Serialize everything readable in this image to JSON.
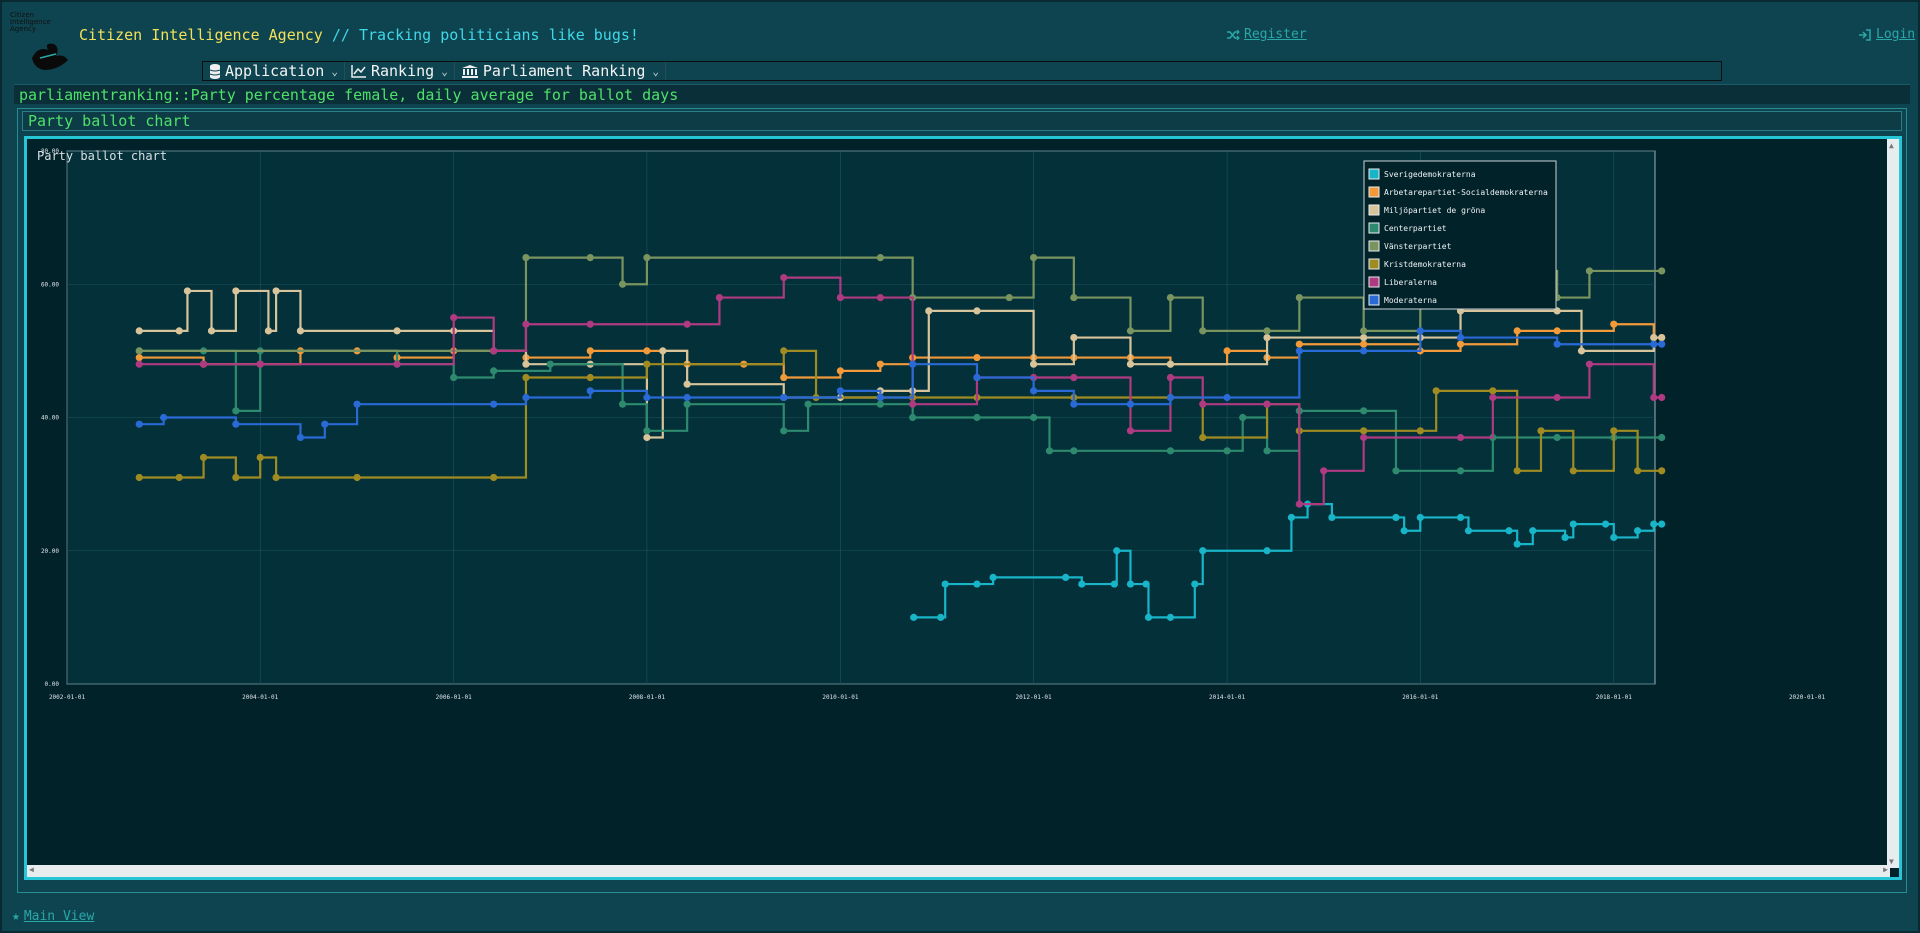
{
  "header": {
    "logo_text": "Citizen Intelligence Agency",
    "title": "Citizen Intelligence Agency",
    "separator": "//",
    "tagline": "Tracking politicians like bugs!",
    "register_label": "Register",
    "login_label": "Login"
  },
  "menubar": {
    "items": [
      {
        "label": "Application",
        "icon": "database-icon"
      },
      {
        "label": "Ranking",
        "icon": "line-chart-icon"
      },
      {
        "label": "Parliament Ranking",
        "icon": "institution-icon"
      }
    ]
  },
  "page": {
    "title": "parliamentranking::Party percentage female, daily average for ballot days",
    "panel_caption": "Party ballot chart",
    "chart_caption": "Party ballot chart"
  },
  "footer": {
    "main_view_label": "Main View"
  },
  "chart_data": {
    "type": "line",
    "title": "Party ballot chart",
    "xlabel": "",
    "ylabel": "",
    "xlim": [
      "2002-01-01",
      "2020-01-01"
    ],
    "ylim": [
      0,
      80
    ],
    "x_ticks": [
      "2002-01-01",
      "2004-01-01",
      "2006-01-01",
      "2008-01-01",
      "2010-01-01",
      "2012-01-01",
      "2014-01-01",
      "2016-01-01",
      "2018-01-01",
      "2020-01-01"
    ],
    "y_ticks": [
      "0.00",
      "20.00",
      "40.00",
      "60.00",
      "80.00"
    ],
    "grid": true,
    "legend_position": "right",
    "series": [
      {
        "name": "Sverigedemokraterna",
        "color": "#18b4c8",
        "points": [
          [
            "2010-10-05",
            10
          ],
          [
            "2011-01-15",
            10
          ],
          [
            "2011-02-01",
            15
          ],
          [
            "2011-06-01",
            15
          ],
          [
            "2011-08-01",
            16
          ],
          [
            "2012-05-01",
            16
          ],
          [
            "2012-07-01",
            15
          ],
          [
            "2012-11-01",
            15
          ],
          [
            "2012-11-10",
            20
          ],
          [
            "2013-01-01",
            15
          ],
          [
            "2013-03-01",
            15
          ],
          [
            "2013-03-10",
            10
          ],
          [
            "2013-06-01",
            10
          ],
          [
            "2013-09-01",
            15
          ],
          [
            "2013-10-01",
            20
          ],
          [
            "2014-06-01",
            20
          ],
          [
            "2014-09-01",
            25
          ],
          [
            "2014-11-01",
            27
          ],
          [
            "2015-02-01",
            25
          ],
          [
            "2015-10-01",
            25
          ],
          [
            "2015-11-01",
            23
          ],
          [
            "2016-01-01",
            25
          ],
          [
            "2016-06-01",
            25
          ],
          [
            "2016-07-01",
            23
          ],
          [
            "2016-12-01",
            23
          ],
          [
            "2017-01-01",
            21
          ],
          [
            "2017-03-01",
            23
          ],
          [
            "2017-07-01",
            22
          ],
          [
            "2017-08-01",
            24
          ],
          [
            "2017-12-01",
            24
          ],
          [
            "2018-01-01",
            22
          ],
          [
            "2018-04-01",
            23
          ],
          [
            "2018-06-01",
            24
          ],
          [
            "2018-07-01",
            24
          ]
        ]
      },
      {
        "name": "Arbetarepartiet-Socialdemokraterna",
        "color": "#f29a3a",
        "points": [
          [
            "2002-10-01",
            49
          ],
          [
            "2003-06-01",
            48
          ],
          [
            "2004-01-01",
            48
          ],
          [
            "2004-06-01",
            50
          ],
          [
            "2005-01-01",
            50
          ],
          [
            "2005-06-01",
            49
          ],
          [
            "2006-01-01",
            50
          ],
          [
            "2006-10-01",
            49
          ],
          [
            "2007-06-01",
            50
          ],
          [
            "2008-01-01",
            50
          ],
          [
            "2008-06-01",
            48
          ],
          [
            "2009-01-01",
            48
          ],
          [
            "2009-06-01",
            46
          ],
          [
            "2010-01-01",
            47
          ],
          [
            "2010-06-01",
            48
          ],
          [
            "2010-10-01",
            49
          ],
          [
            "2011-06-01",
            49
          ],
          [
            "2012-01-01",
            49
          ],
          [
            "2012-06-01",
            49
          ],
          [
            "2013-01-01",
            49
          ],
          [
            "2013-06-01",
            48
          ],
          [
            "2014-01-01",
            50
          ],
          [
            "2014-06-01",
            49
          ],
          [
            "2014-10-01",
            51
          ],
          [
            "2015-06-01",
            51
          ],
          [
            "2016-01-01",
            50
          ],
          [
            "2016-06-01",
            51
          ],
          [
            "2017-01-01",
            53
          ],
          [
            "2017-06-01",
            53
          ],
          [
            "2018-01-01",
            54
          ],
          [
            "2018-06-01",
            52
          ],
          [
            "2018-07-01",
            52
          ]
        ]
      },
      {
        "name": "Miljöpartiet de gröna",
        "color": "#d8c49a",
        "points": [
          [
            "2002-10-01",
            53
          ],
          [
            "2003-03-01",
            53
          ],
          [
            "2003-04-01",
            59
          ],
          [
            "2003-07-01",
            53
          ],
          [
            "2003-10-01",
            59
          ],
          [
            "2004-02-01",
            53
          ],
          [
            "2004-03-01",
            59
          ],
          [
            "2004-06-01",
            53
          ],
          [
            "2005-06-01",
            53
          ],
          [
            "2006-01-01",
            53
          ],
          [
            "2006-06-01",
            50
          ],
          [
            "2006-10-01",
            48
          ],
          [
            "2007-06-01",
            48
          ],
          [
            "2008-01-01",
            37
          ],
          [
            "2008-03-01",
            50
          ],
          [
            "2008-06-01",
            45
          ],
          [
            "2009-06-01",
            43
          ],
          [
            "2010-01-01",
            43
          ],
          [
            "2010-06-01",
            44
          ],
          [
            "2010-10-01",
            44
          ],
          [
            "2010-12-01",
            56
          ],
          [
            "2011-06-01",
            56
          ],
          [
            "2012-01-01",
            48
          ],
          [
            "2012-06-01",
            52
          ],
          [
            "2013-01-01",
            48
          ],
          [
            "2013-06-01",
            48
          ],
          [
            "2014-06-01",
            52
          ],
          [
            "2015-06-01",
            52
          ],
          [
            "2016-01-01",
            52
          ],
          [
            "2016-06-01",
            56
          ],
          [
            "2017-06-01",
            56
          ],
          [
            "2017-09-01",
            50
          ],
          [
            "2018-06-01",
            52
          ],
          [
            "2018-07-01",
            52
          ]
        ]
      },
      {
        "name": "Centerpartiet",
        "color": "#2e8a6e",
        "points": [
          [
            "2002-10-01",
            50
          ],
          [
            "2003-06-01",
            50
          ],
          [
            "2003-10-01",
            41
          ],
          [
            "2004-01-01",
            50
          ],
          [
            "2005-06-01",
            48
          ],
          [
            "2006-01-01",
            46
          ],
          [
            "2006-06-01",
            47
          ],
          [
            "2007-01-01",
            48
          ],
          [
            "2007-10-01",
            42
          ],
          [
            "2008-01-01",
            38
          ],
          [
            "2008-06-01",
            42
          ],
          [
            "2009-06-01",
            38
          ],
          [
            "2009-09-01",
            42
          ],
          [
            "2010-06-01",
            42
          ],
          [
            "2010-10-01",
            40
          ],
          [
            "2011-06-01",
            40
          ],
          [
            "2012-01-01",
            40
          ],
          [
            "2012-03-01",
            35
          ],
          [
            "2012-06-01",
            35
          ],
          [
            "2013-06-01",
            35
          ],
          [
            "2014-01-01",
            35
          ],
          [
            "2014-03-01",
            40
          ],
          [
            "2014-06-01",
            35
          ],
          [
            "2014-10-01",
            41
          ],
          [
            "2015-06-01",
            41
          ],
          [
            "2015-10-01",
            32
          ],
          [
            "2016-06-01",
            32
          ],
          [
            "2016-10-01",
            37
          ],
          [
            "2017-06-01",
            37
          ],
          [
            "2018-01-01",
            37
          ],
          [
            "2018-07-01",
            37
          ]
        ]
      },
      {
        "name": "Vänsterpartiet",
        "color": "#7a9460",
        "points": [
          [
            "2002-10-01",
            50
          ],
          [
            "2006-06-01",
            50
          ],
          [
            "2006-10-01",
            64
          ],
          [
            "2007-06-01",
            64
          ],
          [
            "2007-10-01",
            60
          ],
          [
            "2008-01-01",
            64
          ],
          [
            "2010-06-01",
            64
          ],
          [
            "2010-10-01",
            58
          ],
          [
            "2011-10-01",
            58
          ],
          [
            "2012-01-01",
            64
          ],
          [
            "2012-06-01",
            58
          ],
          [
            "2013-01-01",
            53
          ],
          [
            "2013-06-01",
            58
          ],
          [
            "2013-10-01",
            53
          ],
          [
            "2014-06-01",
            53
          ],
          [
            "2014-10-01",
            58
          ],
          [
            "2015-06-01",
            53
          ],
          [
            "2016-01-01",
            58
          ],
          [
            "2016-06-01",
            62
          ],
          [
            "2017-06-01",
            58
          ],
          [
            "2017-10-01",
            62
          ],
          [
            "2018-07-01",
            62
          ]
        ]
      },
      {
        "name": "Kristdemokraterna",
        "color": "#a08b22",
        "points": [
          [
            "2002-10-01",
            31
          ],
          [
            "2003-03-01",
            31
          ],
          [
            "2003-06-01",
            34
          ],
          [
            "2003-10-01",
            31
          ],
          [
            "2004-01-01",
            34
          ],
          [
            "2004-03-01",
            31
          ],
          [
            "2005-01-01",
            31
          ],
          [
            "2006-06-01",
            31
          ],
          [
            "2006-10-01",
            46
          ],
          [
            "2007-06-01",
            46
          ],
          [
            "2008-01-01",
            48
          ],
          [
            "2009-06-01",
            50
          ],
          [
            "2009-10-01",
            43
          ],
          [
            "2010-06-01",
            43
          ],
          [
            "2010-10-01",
            43
          ],
          [
            "2011-06-01",
            43
          ],
          [
            "2012-06-01",
            43
          ],
          [
            "2013-06-01",
            43
          ],
          [
            "2013-10-01",
            37
          ],
          [
            "2014-06-01",
            42
          ],
          [
            "2014-10-01",
            38
          ],
          [
            "2015-06-01",
            38
          ],
          [
            "2016-01-01",
            38
          ],
          [
            "2016-03-01",
            44
          ],
          [
            "2016-10-01",
            44
          ],
          [
            "2017-01-01",
            32
          ],
          [
            "2017-04-01",
            38
          ],
          [
            "2017-08-01",
            32
          ],
          [
            "2018-01-01",
            38
          ],
          [
            "2018-04-01",
            32
          ],
          [
            "2018-07-01",
            32
          ]
        ]
      },
      {
        "name": "Liberalerna",
        "color": "#b03a82",
        "points": [
          [
            "2002-10-01",
            48
          ],
          [
            "2003-06-01",
            48
          ],
          [
            "2004-01-01",
            48
          ],
          [
            "2005-06-01",
            48
          ],
          [
            "2006-01-01",
            55
          ],
          [
            "2006-06-01",
            50
          ],
          [
            "2006-10-01",
            54
          ],
          [
            "2007-06-01",
            54
          ],
          [
            "2008-06-01",
            54
          ],
          [
            "2008-10-01",
            58
          ],
          [
            "2009-06-01",
            61
          ],
          [
            "2010-01-01",
            58
          ],
          [
            "2010-06-01",
            58
          ],
          [
            "2010-10-01",
            42
          ],
          [
            "2011-06-01",
            46
          ],
          [
            "2012-01-01",
            46
          ],
          [
            "2012-06-01",
            46
          ],
          [
            "2013-01-01",
            38
          ],
          [
            "2013-06-01",
            46
          ],
          [
            "2013-10-01",
            42
          ],
          [
            "2014-06-01",
            42
          ],
          [
            "2014-10-01",
            27
          ],
          [
            "2015-01-01",
            32
          ],
          [
            "2015-06-01",
            37
          ],
          [
            "2016-06-01",
            37
          ],
          [
            "2016-10-01",
            43
          ],
          [
            "2017-06-01",
            43
          ],
          [
            "2017-10-01",
            48
          ],
          [
            "2018-06-01",
            43
          ],
          [
            "2018-07-01",
            43
          ]
        ]
      },
      {
        "name": "Moderaterna",
        "color": "#2a6ad6",
        "points": [
          [
            "2002-10-01",
            39
          ],
          [
            "2003-01-01",
            40
          ],
          [
            "2003-10-01",
            39
          ],
          [
            "2004-06-01",
            37
          ],
          [
            "2004-09-01",
            39
          ],
          [
            "2005-01-01",
            42
          ],
          [
            "2006-06-01",
            42
          ],
          [
            "2006-10-01",
            43
          ],
          [
            "2007-06-01",
            44
          ],
          [
            "2008-01-01",
            43
          ],
          [
            "2008-06-01",
            43
          ],
          [
            "2009-06-01",
            43
          ],
          [
            "2010-01-01",
            44
          ],
          [
            "2010-06-01",
            43
          ],
          [
            "2010-10-01",
            48
          ],
          [
            "2011-06-01",
            46
          ],
          [
            "2012-01-01",
            44
          ],
          [
            "2012-06-01",
            42
          ],
          [
            "2013-01-01",
            42
          ],
          [
            "2013-06-01",
            43
          ],
          [
            "2014-01-01",
            43
          ],
          [
            "2014-10-01",
            50
          ],
          [
            "2015-06-01",
            50
          ],
          [
            "2016-01-01",
            53
          ],
          [
            "2016-06-01",
            52
          ],
          [
            "2017-06-01",
            51
          ],
          [
            "2018-06-01",
            51
          ],
          [
            "2018-07-01",
            51
          ]
        ]
      }
    ]
  }
}
